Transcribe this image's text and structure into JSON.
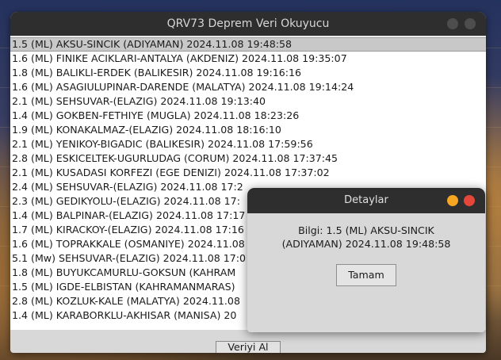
{
  "main_window": {
    "title": "QRV73 Deprem Veri Okuyucu",
    "list_items": [
      "1.5 (ML) AKSU-SINCIK (ADIYAMAN) 2024.11.08 19:48:58",
      "1.6 (ML) FINIKE ACIKLARI-ANTALYA (AKDENIZ) 2024.11.08 19:35:07",
      "1.8 (ML) BALIKLI-ERDEK (BALIKESIR) 2024.11.08 19:16:16",
      "1.6 (ML) ASAGIULUPINAR-DARENDE (MALATYA) 2024.11.08 19:14:24",
      "2.1 (ML) SEHSUVAR-(ELAZIG) 2024.11.08 19:13:40",
      "1.4 (ML) GOKBEN-FETHIYE (MUGLA) 2024.11.08 18:23:26",
      "1.9 (ML) KONAKALMAZ-(ELAZIG) 2024.11.08 18:16:10",
      "2.1 (ML) YENIKOY-BIGADIC (BALIKESIR) 2024.11.08 17:59:56",
      "2.8 (ML) ESKICELTEK-UGURLUDAG (CORUM) 2024.11.08 17:37:45",
      "2.1 (ML) KUSADASI KORFEZI (EGE DENIZI) 2024.11.08 17:37:02",
      "2.4 (ML) SEHSUVAR-(ELAZIG) 2024.11.08 17:2",
      "2.3 (ML) GEDIKYOLU-(ELAZIG) 2024.11.08 17:",
      "1.4 (ML) BALPINAR-(ELAZIG) 2024.11.08 17:17",
      "1.7 (ML) KIRACKOY-(ELAZIG) 2024.11.08 17:16",
      "1.6 (ML) TOPRAKKALE (OSMANIYE) 2024.11.08",
      "5.1 (Mw) SEHSUVAR-(ELAZIG) 2024.11.08 17:0",
      "1.8 (ML) BUYUKCAMURLU-GOKSUN (KAHRAM",
      "1.5 (ML) IGDE-ELBISTAN (KAHRAMANMARAS)",
      "2.8 (ML) KOZLUK-KALE (MALATYA) 2024.11.08",
      "1.4 (ML) KARABORKLU-AKHISAR (MANISA) 20"
    ],
    "selected_index": 0,
    "fetch_button_label": "Veriyi Al"
  },
  "dialog": {
    "title": "Detaylar",
    "message_line1": "Bilgi: 1.5 (ML) AKSU-SINCIK",
    "message_line2": "(ADIYAMAN) 2024.11.08 19:48:58",
    "ok_button_label": "Tamam"
  },
  "colors": {
    "titlebar": "#2e2e2e",
    "window_bg": "#d8d8d8",
    "selection": "#c8c8c8",
    "minimize": "#f5a623",
    "close": "#e5463a"
  }
}
